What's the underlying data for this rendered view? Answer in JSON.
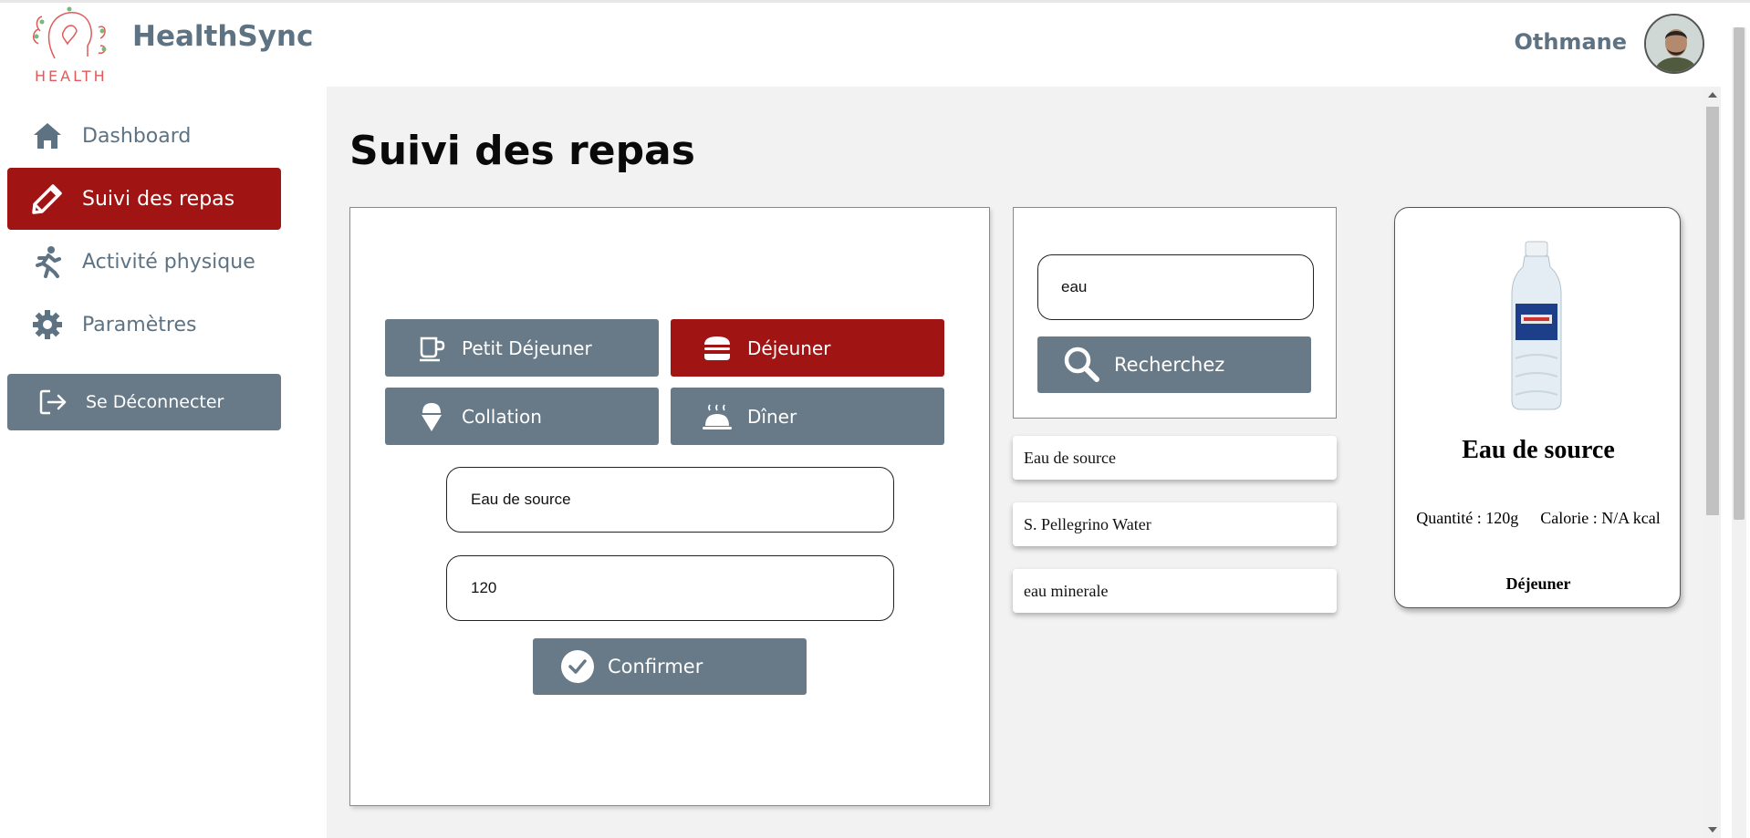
{
  "header": {
    "brand_text": "HEALTH",
    "app_name": "HealthSync",
    "user_name": "Othmane"
  },
  "sidebar": {
    "items": [
      {
        "label": "Dashboard",
        "icon": "home-icon"
      },
      {
        "label": "Suivi des repas",
        "icon": "pencil-icon",
        "active": true
      },
      {
        "label": "Activité physique",
        "icon": "running-icon"
      },
      {
        "label": "Paramètres",
        "icon": "gear-icon"
      }
    ],
    "logout_label": "Se Déconnecter"
  },
  "main": {
    "title": "Suivi des repas",
    "meals": [
      {
        "label": "Petit Déjeuner",
        "icon": "coffee-cup-icon"
      },
      {
        "label": "Déjeuner",
        "icon": "burger-icon",
        "selected": true
      },
      {
        "label": "Collation",
        "icon": "ice-cream-icon"
      },
      {
        "label": "Dîner",
        "icon": "cloche-icon"
      }
    ],
    "food_name_value": "Eau de source",
    "quantity_value": "120",
    "confirm_label": "Confirmer",
    "search": {
      "value": "eau",
      "button_label": "Recherchez"
    },
    "results": [
      "Eau de source",
      "S. Pellegrino Water",
      "eau minerale"
    ],
    "product": {
      "name": "Eau de source",
      "quantity": "Quantité : 120g",
      "calorie": "Calorie : N/A kcal",
      "meal": "Déjeuner",
      "image": "water-bottle"
    }
  },
  "colors": {
    "accent_red": "#a01414",
    "button_slate": "#687a88",
    "text_slate": "#5d7282",
    "background": "#f2f2f2"
  }
}
